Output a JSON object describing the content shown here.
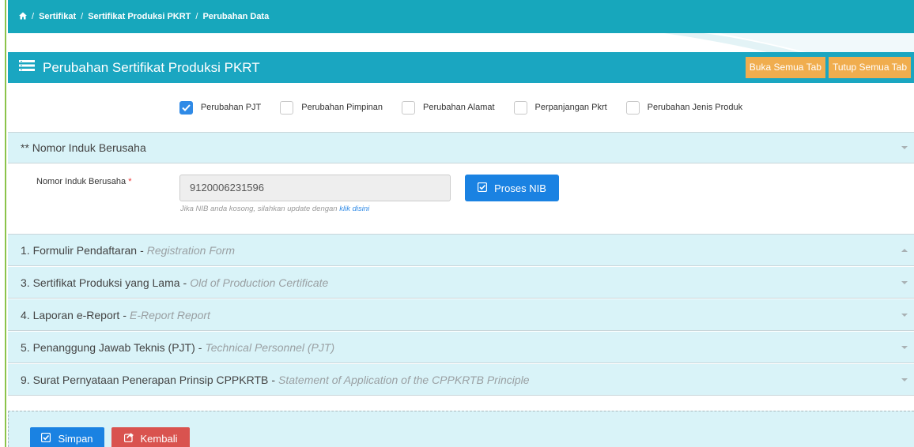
{
  "breadcrumb": {
    "items": [
      "Sertifikat",
      "Sertifikat Produksi PKRT",
      "Perubahan Data"
    ]
  },
  "panel": {
    "title": "Perubahan Sertifikat Produksi PKRT",
    "open_all_label": "Buka Semua Tab",
    "close_all_label": "Tutup Semua Tab"
  },
  "checkboxes": [
    {
      "label": "Perubahan PJT",
      "checked": true
    },
    {
      "label": "Perubahan Pimpinan",
      "checked": false
    },
    {
      "label": "Perubahan Alamat",
      "checked": false
    },
    {
      "label": "Perpanjangan Pkrt",
      "checked": false
    },
    {
      "label": "Perubahan Jenis Produk",
      "checked": false
    }
  ],
  "nib_section": {
    "title": "** Nomor Induk Berusaha",
    "field_label": "Nomor Induk Berusaha",
    "required_mark": "*",
    "value": "9120006231596",
    "help_text": "Jika NIB anda kosong, silahkan update dengan ",
    "help_link": "klik disini",
    "process_label": "Proses NIB"
  },
  "sections": [
    {
      "title": "1. Formulir Pendaftaran",
      "subtitle": "Registration Form",
      "open": true
    },
    {
      "title": "3. Sertifikat Produksi yang Lama",
      "subtitle": "Old of Production Certificate",
      "open": false
    },
    {
      "title": "4. Laporan e-Report",
      "subtitle": "E-Report Report",
      "open": false
    },
    {
      "title": "5. Penanggung Jawab Teknis (PJT)",
      "subtitle": "Technical Personnel (PJT)",
      "open": false
    },
    {
      "title": "9. Surat Pernyataan Penerapan Prinsip CPPKRTB",
      "subtitle": "Statement of Application of the CPPKRTB Principle",
      "open": false
    }
  ],
  "section_separator": "-",
  "footer": {
    "save_label": "Simpan",
    "back_label": "Kembali"
  },
  "colors": {
    "header_teal": "#17a7bc",
    "accordion_bg": "#d9f3f8",
    "primary_blue": "#1a82e2",
    "warning_orange": "#f0ad4e",
    "danger_red": "#d9534f"
  },
  "icons": {
    "breadcrumb_home": "home-icon",
    "panel": "list-icon",
    "process": "check-square-icon",
    "save": "check-square-icon",
    "back": "share-icon"
  }
}
